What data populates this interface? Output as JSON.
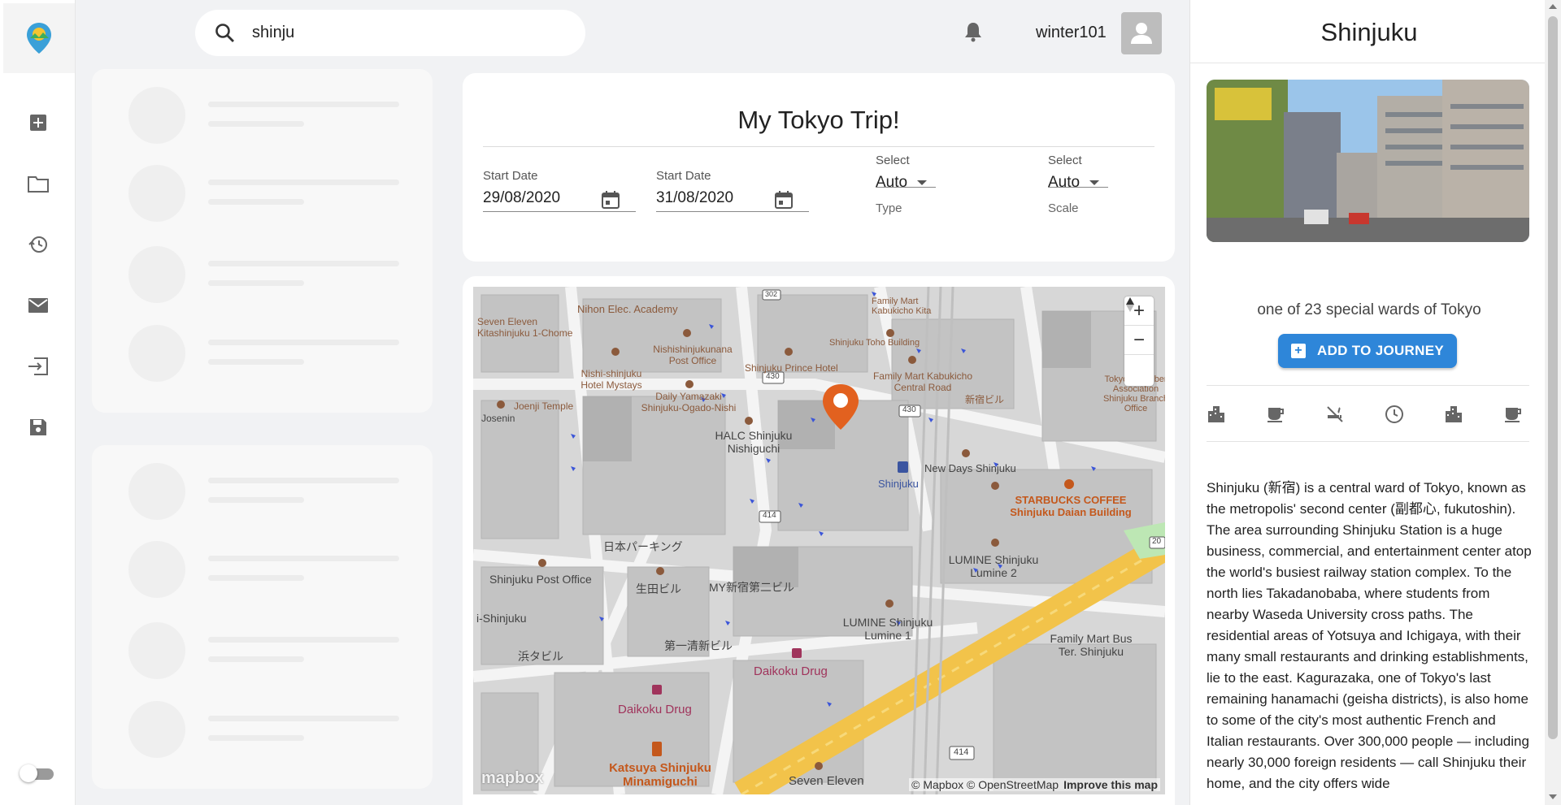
{
  "search": {
    "value": "shinju",
    "icon": "search-icon"
  },
  "header": {
    "username": "winter101",
    "icons": [
      "bell-icon",
      "avatar-icon"
    ]
  },
  "sidebar": {
    "logo": "app-logo-pin",
    "items": [
      {
        "icon": "add-box-icon"
      },
      {
        "icon": "folder-icon"
      },
      {
        "icon": "history-icon"
      },
      {
        "icon": "mail-icon"
      },
      {
        "icon": "login-icon"
      },
      {
        "icon": "save-icon"
      }
    ],
    "theme_toggle": {
      "on": false
    }
  },
  "trip": {
    "title": "My Tokyo Trip!",
    "start_date_1": {
      "label": "Start Date",
      "value": "29/08/2020"
    },
    "start_date_2": {
      "label": "Start Date",
      "value": "31/08/2020"
    },
    "type_select": {
      "label": "Select",
      "value": "Auto",
      "helper": "Type"
    },
    "scale_select": {
      "label": "Select",
      "value": "Auto",
      "helper": "Scale"
    }
  },
  "map": {
    "controls": {
      "zoom_in": "+",
      "zoom_out": "−",
      "compass": "compass-icon"
    },
    "logo_text": "mapbox",
    "attribution": "© Mapbox © OpenStreetMap",
    "improve": "Improve this map",
    "labels": {
      "l1": "Nihon Elec. Academy",
      "l2": "Family Mart Kabukicho Kita",
      "l3": "Seven Eleven Kitashinjuku 1-Chome",
      "l4": "Nishishinjukunana Post Office",
      "l5": "Shinjuku Toho Building",
      "l6": "Nishi-shinjuku Hotel Mystays",
      "l7": "Shinjuku Prince Hotel",
      "l8": "Family Mart Kabukicho Central Road",
      "l9": "Joenji Temple",
      "l10": "Daily Yamazaki Shinjuku-Ogado-Nishi",
      "l11": "Josenin",
      "l12": "HALC Shinjuku Nishiguchi",
      "l13": "新宿ビル",
      "l14": "Tokyo Chamber Association Shinjuku Branch Office",
      "l15": "New Days Shinjuku",
      "l16": "Shinjuku",
      "l17": "STARBUCKS COFFEE Shinjuku Daian Building",
      "l18": "日本パーキング",
      "l19": "Shinjuku Post Office",
      "l20": "生田ビル",
      "l21": "MY新宿第二ビル",
      "l22": "LUMINE Shinjuku Lumine 2",
      "l23": "LUMINE Shinjuku Lumine 1",
      "l24": "Family Mart Bus Ter. Shinjuku",
      "l25": "i-Shinjuku",
      "l26": "浜タビル",
      "l27": "第一清新ビル",
      "l28": "Daikoku Drug",
      "l29": "Daikoku Drug",
      "l30": "Katsuya Shinjuku Minamiguchi",
      "l31": "Seven Eleven",
      "r430a": "430",
      "r430b": "430",
      "r414a": "414",
      "r414b": "414",
      "r302": "302",
      "r20": "20"
    }
  },
  "place": {
    "title": "Shinjuku",
    "subtitle": "one of 23 special wards of Tokyo",
    "add_button": "ADD TO JOURNEY",
    "amenity_icons": [
      "city-icon",
      "coffee-icon",
      "no-smoking-icon",
      "clock-icon",
      "city-icon",
      "coffee-icon"
    ],
    "description": "Shinjuku (新宿) is a central ward of Tokyo, known as the metropolis' second center (副都心, fukutoshin). The area surrounding Shinjuku Station is a huge business, commercial, and entertainment center atop the world's busiest railway station complex. To the north lies Takadanobaba, where students from nearby Waseda University cross paths. The residential areas of Yotsuya and Ichigaya, with their many small restaurants and drinking establishments, lie to the east. Kagurazaka, one of Tokyo's last remaining hanamachi (geisha districts), is also home to some of the city's most authentic French and Italian restaurants. Over 300,000 people — including nearly 30,000 foreign residents — call Shinjuku their home, and the city offers wide"
  },
  "colors": {
    "accent": "#2e86d9",
    "marker": "#e2611f",
    "road": "#f2c34a"
  }
}
